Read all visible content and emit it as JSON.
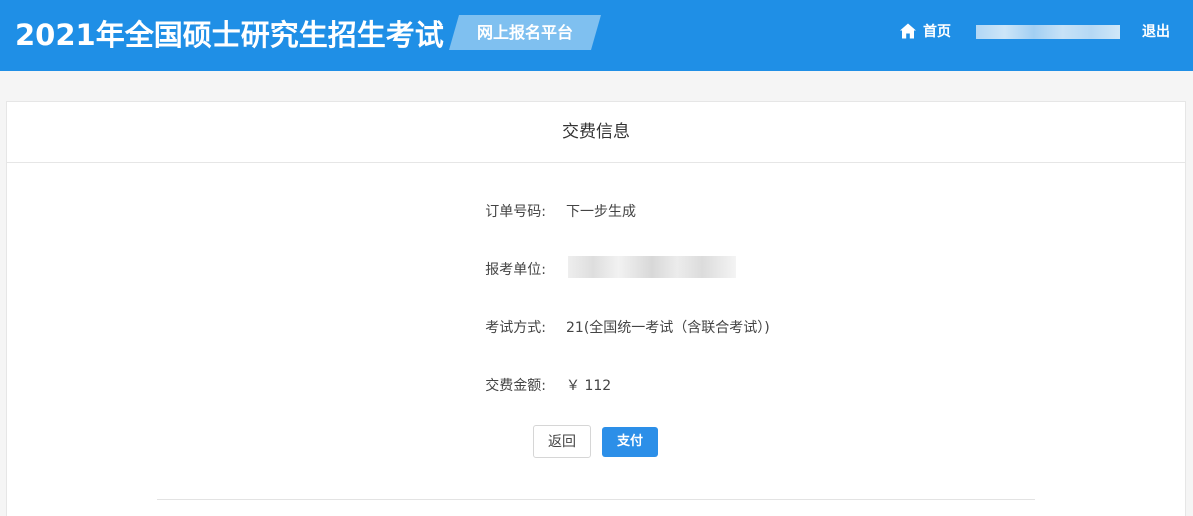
{
  "header": {
    "site_title": "2021年全国硕士研究生招生考试",
    "platform_label": "网上报名平台",
    "home_icon": "home-icon",
    "home_label": "首页",
    "logout_label": "退出"
  },
  "panel": {
    "title": "交费信息",
    "rows": [
      {
        "label": "订单号码:",
        "value": "下一步生成"
      },
      {
        "label": "报考单位:",
        "value": ""
      },
      {
        "label": "考试方式:",
        "value": "21(全国统一考试（含联合考试）)"
      },
      {
        "label": "交费金额:",
        "value": "￥ 112"
      }
    ],
    "back_button": "返回",
    "pay_button": "支付"
  },
  "colors": {
    "header_bg": "#1f8fe6",
    "badge_bg": "#7fc0f0",
    "pay_button_bg": "#2c8fe8"
  }
}
